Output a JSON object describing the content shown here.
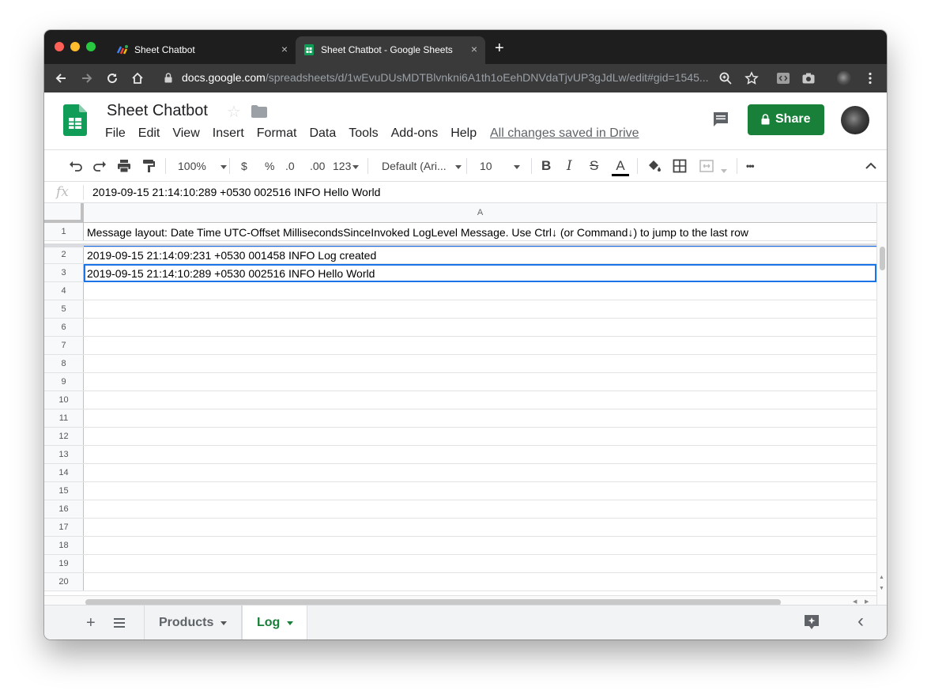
{
  "browser": {
    "tabs": [
      {
        "title": "Sheet Chatbot",
        "active": false
      },
      {
        "title": "Sheet Chatbot - Google Sheets",
        "active": true
      }
    ],
    "close_glyph": "×",
    "new_tab_glyph": "+",
    "url_host": "docs.google.com",
    "url_path": "/spreadsheets/d/1wEvuDUsMDTBlvnkni6A1th1oEehDNVdaTjvUP3gJdLw/edit#gid=1545..."
  },
  "doc": {
    "title": "Sheet Chatbot",
    "menu": [
      "File",
      "Edit",
      "View",
      "Insert",
      "Format",
      "Data",
      "Tools",
      "Add-ons",
      "Help"
    ],
    "saved_status": "All changes saved in Drive",
    "share_label": "Share"
  },
  "format_toolbar": {
    "zoom": "100%",
    "currency": "$",
    "percent": "%",
    "decrease_decimal": ".0",
    "increase_decimal": ".00",
    "more_formats": "123",
    "font": "Default (Ari...",
    "font_size": "10",
    "bold": "B",
    "italic": "I",
    "strikethrough": "S",
    "text_color": "A",
    "more": "•••"
  },
  "formula_bar": {
    "fx_label": "fx",
    "value": "2019-09-15 21:14:10:289 +0530 002516 INFO Hello World"
  },
  "grid": {
    "column_header": "A",
    "rows": [
      {
        "num": "1",
        "value": "Message layout: Date Time UTC-Offset MillisecondsSinceInvoked LogLevel Message. Use Ctrl↓ (or Command↓) to jump to the last row"
      },
      {
        "num": "2",
        "value": "2019-09-15 21:14:09:231 +0530 001458 INFO Log created"
      },
      {
        "num": "3",
        "value": "2019-09-15 21:14:10:289 +0530 002516 INFO Hello World"
      },
      {
        "num": "4",
        "value": ""
      },
      {
        "num": "5",
        "value": ""
      },
      {
        "num": "6",
        "value": ""
      },
      {
        "num": "7",
        "value": ""
      },
      {
        "num": "8",
        "value": ""
      },
      {
        "num": "9",
        "value": ""
      },
      {
        "num": "10",
        "value": ""
      },
      {
        "num": "11",
        "value": ""
      },
      {
        "num": "12",
        "value": ""
      },
      {
        "num": "13",
        "value": ""
      },
      {
        "num": "14",
        "value": ""
      },
      {
        "num": "15",
        "value": ""
      },
      {
        "num": "16",
        "value": ""
      },
      {
        "num": "17",
        "value": ""
      },
      {
        "num": "18",
        "value": ""
      },
      {
        "num": "19",
        "value": ""
      },
      {
        "num": "20",
        "value": ""
      }
    ],
    "selected_row": "3"
  },
  "sheet_tabs": {
    "add_glyph": "+",
    "tabs": [
      {
        "label": "Products",
        "active": false
      },
      {
        "label": "Log",
        "active": true
      }
    ],
    "collapse_glyph": "‹"
  },
  "colors": {
    "sheets_green": "#188038",
    "selection_blue": "#1a73e8"
  }
}
